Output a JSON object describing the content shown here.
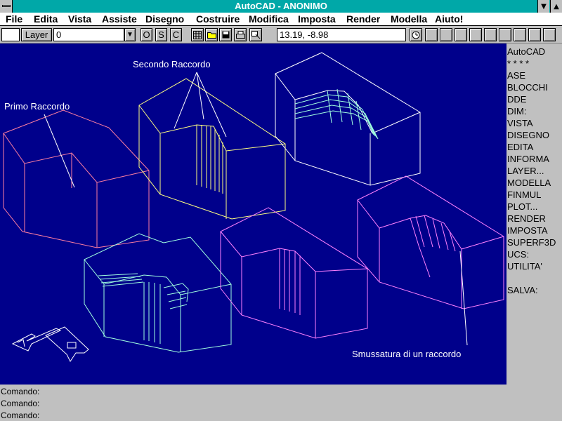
{
  "window": {
    "title": "AutoCAD - ANONIMO"
  },
  "menu": [
    "File",
    "Edita",
    "Vista",
    "Assiste",
    "Disegno",
    "Costruire",
    "Modifica",
    "Imposta",
    "Render",
    "Modella",
    "Aiuto!"
  ],
  "toolbar": {
    "layer_button": "Layer",
    "layer_value": "0",
    "osnap_buttons": [
      "O",
      "S",
      "C"
    ],
    "coordinates": "13.19, -8.98"
  },
  "drawing": {
    "labels": {
      "primo": "Primo Raccordo",
      "secondo": "Secondo Raccordo",
      "smussatura": "Smussatura di un raccordo"
    },
    "colors": {
      "background": "#00008b",
      "red": "#ff7fa0",
      "yellow": "#ffff80",
      "cyan": "#a0ffe0",
      "magenta": "#ff80ff",
      "white": "#ffffff"
    }
  },
  "side_menu": [
    "AutoCAD",
    "* * * *",
    "ASE",
    "BLOCCHI",
    "DDE",
    "DIM:",
    "VISTA",
    "DISEGNO",
    "EDITA",
    "INFORMA",
    "LAYER...",
    "MODELLA",
    "FINMUL",
    "PLOT...",
    "RENDER",
    "IMPOSTA",
    "SUPERF3D",
    "UCS:",
    "UTILITA'",
    "",
    "SALVA:"
  ],
  "command_lines": [
    "Comando:",
    "Comando:",
    "Comando:"
  ]
}
